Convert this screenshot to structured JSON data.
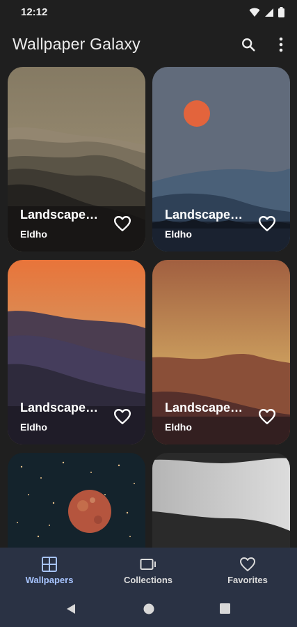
{
  "status_bar": {
    "time": "12:12"
  },
  "app_bar": {
    "title": "Wallpaper Galaxy",
    "search_icon": "search-icon",
    "more_icon": "more-vert-icon"
  },
  "wallpapers": [
    {
      "title": "Landscape…",
      "author": "Eldho"
    },
    {
      "title": "Landscape…",
      "author": "Eldho"
    },
    {
      "title": "Landscape…",
      "author": "Eldho"
    },
    {
      "title": "Landscape…",
      "author": "Eldho"
    },
    {
      "title": "",
      "author": ""
    },
    {
      "title": "",
      "author": ""
    }
  ],
  "bottom_nav": {
    "items": [
      {
        "label": "Wallpapers",
        "icon": "grid-icon",
        "active": true
      },
      {
        "label": "Collections",
        "icon": "collections-icon",
        "active": false
      },
      {
        "label": "Favorites",
        "icon": "heart-icon",
        "active": false
      }
    ]
  },
  "colors": {
    "accent": "#a7c4ff",
    "nav_bg": "#2a3244",
    "background": "#1f1f1f"
  }
}
